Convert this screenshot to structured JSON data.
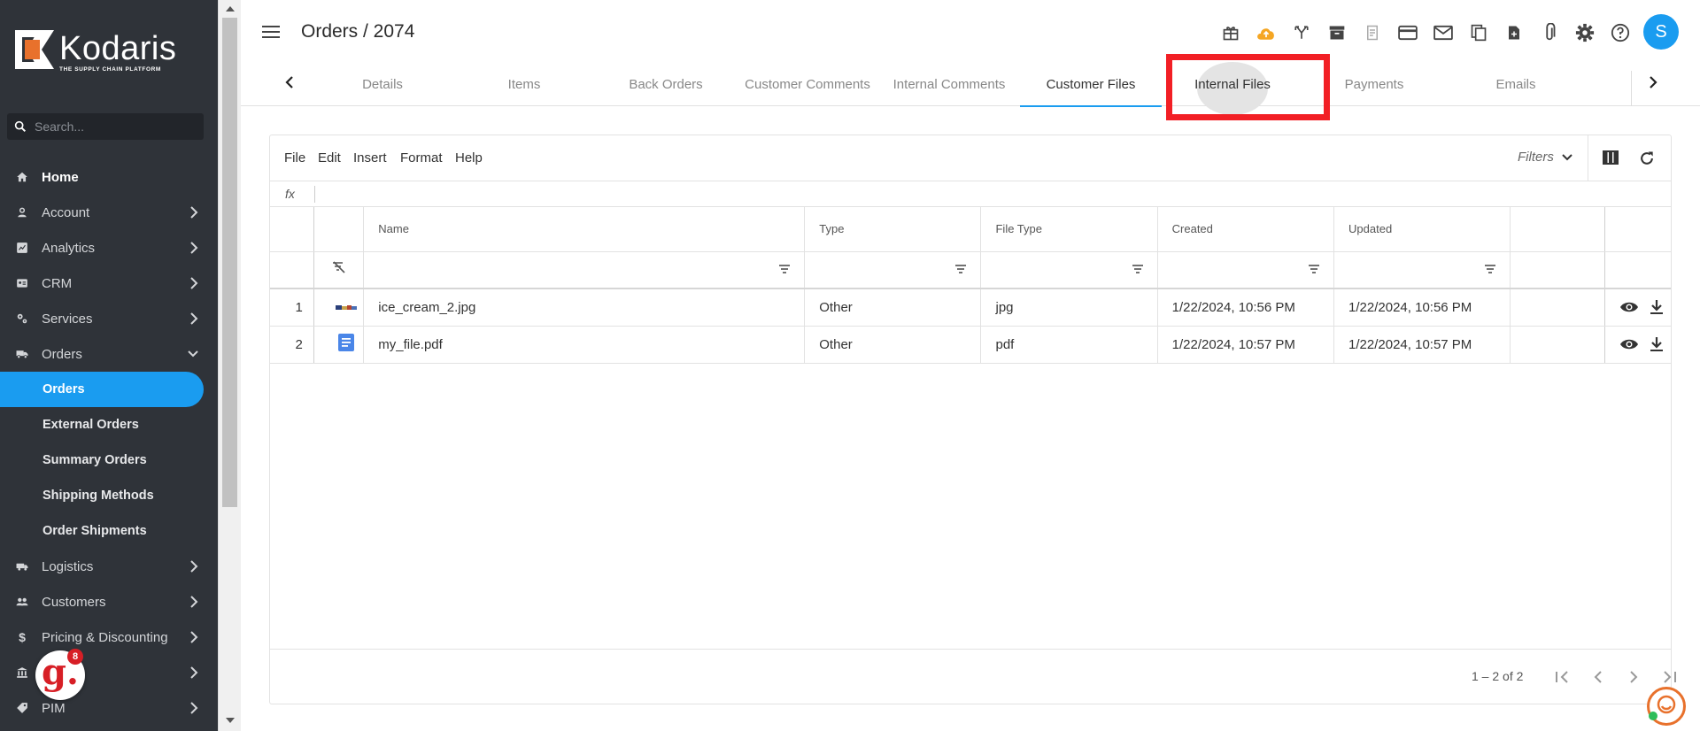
{
  "brand": {
    "name": "Kodaris",
    "tagline": "THE SUPPLY CHAIN PLATFORM",
    "accent": "#1a9cf0",
    "sidebar_bg": "#2f3339",
    "logo_orange": "#e8712c"
  },
  "search": {
    "placeholder": "Search..."
  },
  "sidebar": {
    "items": [
      {
        "label": "Home",
        "icon": "home-icon"
      },
      {
        "label": "Account",
        "icon": "person-icon"
      },
      {
        "label": "Analytics",
        "icon": "analytics-icon"
      },
      {
        "label": "CRM",
        "icon": "crm-icon"
      },
      {
        "label": "Services",
        "icon": "services-icon"
      },
      {
        "label": "Orders",
        "icon": "truck-icon"
      },
      {
        "label": "Logistics",
        "icon": "logistics-icon"
      },
      {
        "label": "Customers",
        "icon": "group-icon"
      },
      {
        "label": "Pricing & Discounting",
        "icon": "dollar-icon"
      },
      {
        "label": "",
        "icon": "bank-icon"
      },
      {
        "label": "PIM",
        "icon": "tag-icon"
      }
    ],
    "orders_sub": [
      "Orders",
      "External Orders",
      "Summary Orders",
      "Shipping Methods",
      "Order Shipments"
    ],
    "badge_count": "8"
  },
  "header": {
    "title": "Orders / 2074",
    "avatar_letter": "S",
    "icons": [
      "gift-icon",
      "cloud-upload-icon",
      "merge-icon",
      "archive-icon",
      "receipt-icon",
      "credit-card-icon",
      "mail-icon",
      "copy-icon",
      "note-add-icon",
      "attachment-icon",
      "settings-icon",
      "help-icon"
    ]
  },
  "tabs": [
    {
      "label": "Details"
    },
    {
      "label": "Items"
    },
    {
      "label": "Back Orders"
    },
    {
      "label": "Customer Comments"
    },
    {
      "label": "Internal Comments"
    },
    {
      "label": "Customer Files",
      "active": true
    },
    {
      "label": "Internal Files",
      "highlighted": true
    },
    {
      "label": "Payments"
    },
    {
      "label": "Emails"
    }
  ],
  "grid": {
    "menu": [
      "File",
      "Edit",
      "Insert",
      "Format",
      "Help"
    ],
    "filters_label": "Filters",
    "fx_label": "fx",
    "columns": [
      "Name",
      "Type",
      "File Type",
      "Created",
      "Updated"
    ],
    "rows": [
      {
        "num": "1",
        "thumb": "image-thumbnail",
        "name": "ice_cream_2.jpg",
        "type": "Other",
        "file_type": "jpg",
        "created": "1/22/2024, 10:56 PM",
        "updated": "1/22/2024, 10:56 PM"
      },
      {
        "num": "2",
        "thumb": "document-icon",
        "name": "my_file.pdf",
        "type": "Other",
        "file_type": "pdf",
        "created": "1/22/2024, 10:57 PM",
        "updated": "1/22/2024, 10:57 PM"
      }
    ],
    "range": "1 – 2 of 2"
  }
}
